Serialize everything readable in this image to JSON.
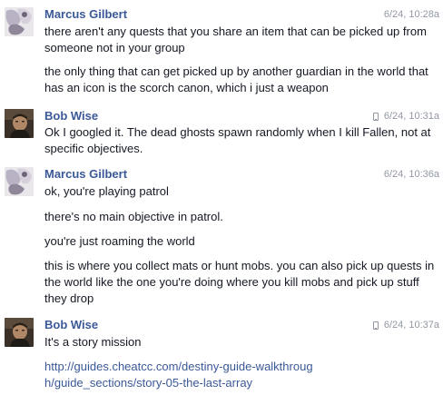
{
  "messages": [
    {
      "sender": "Marcus Gilbert",
      "time": "6/24, 10:28a",
      "mobile": false,
      "avatar": "marcus-avatar",
      "paragraphs": [
        "there aren't any quests that you share an item that can be picked up from someone not in your group",
        "the only thing that can get picked up by another guardian in the world that has an icon is the scorch canon, which i just a weapon"
      ]
    },
    {
      "sender": "Bob Wise",
      "time": "6/24, 10:31a",
      "mobile": true,
      "avatar": "bob-avatar",
      "paragraphs": [
        "Ok I googled it. The dead ghosts spawn randomly when I kill Fallen, not at specific objectives."
      ]
    },
    {
      "sender": "Marcus Gilbert",
      "time": "6/24, 10:36a",
      "mobile": false,
      "avatar": "marcus-avatar",
      "paragraphs": [
        "ok, you're playing patrol",
        "there's no main objective in patrol.",
        "you're just roaming the world",
        "this is where you collect mats or hunt mobs. you can also pick up quests in the world like the one you're doing where you kill mobs and pick up stuff they drop"
      ]
    },
    {
      "sender": "Bob Wise",
      "time": "6/24, 10:37a",
      "mobile": true,
      "avatar": "bob-avatar",
      "paragraphs": [
        "It's a story mission"
      ],
      "link": "http://guides.cheatcc.com/destiny-guide-walkthrough/guide_sections/story-05-the-last-array"
    }
  ]
}
